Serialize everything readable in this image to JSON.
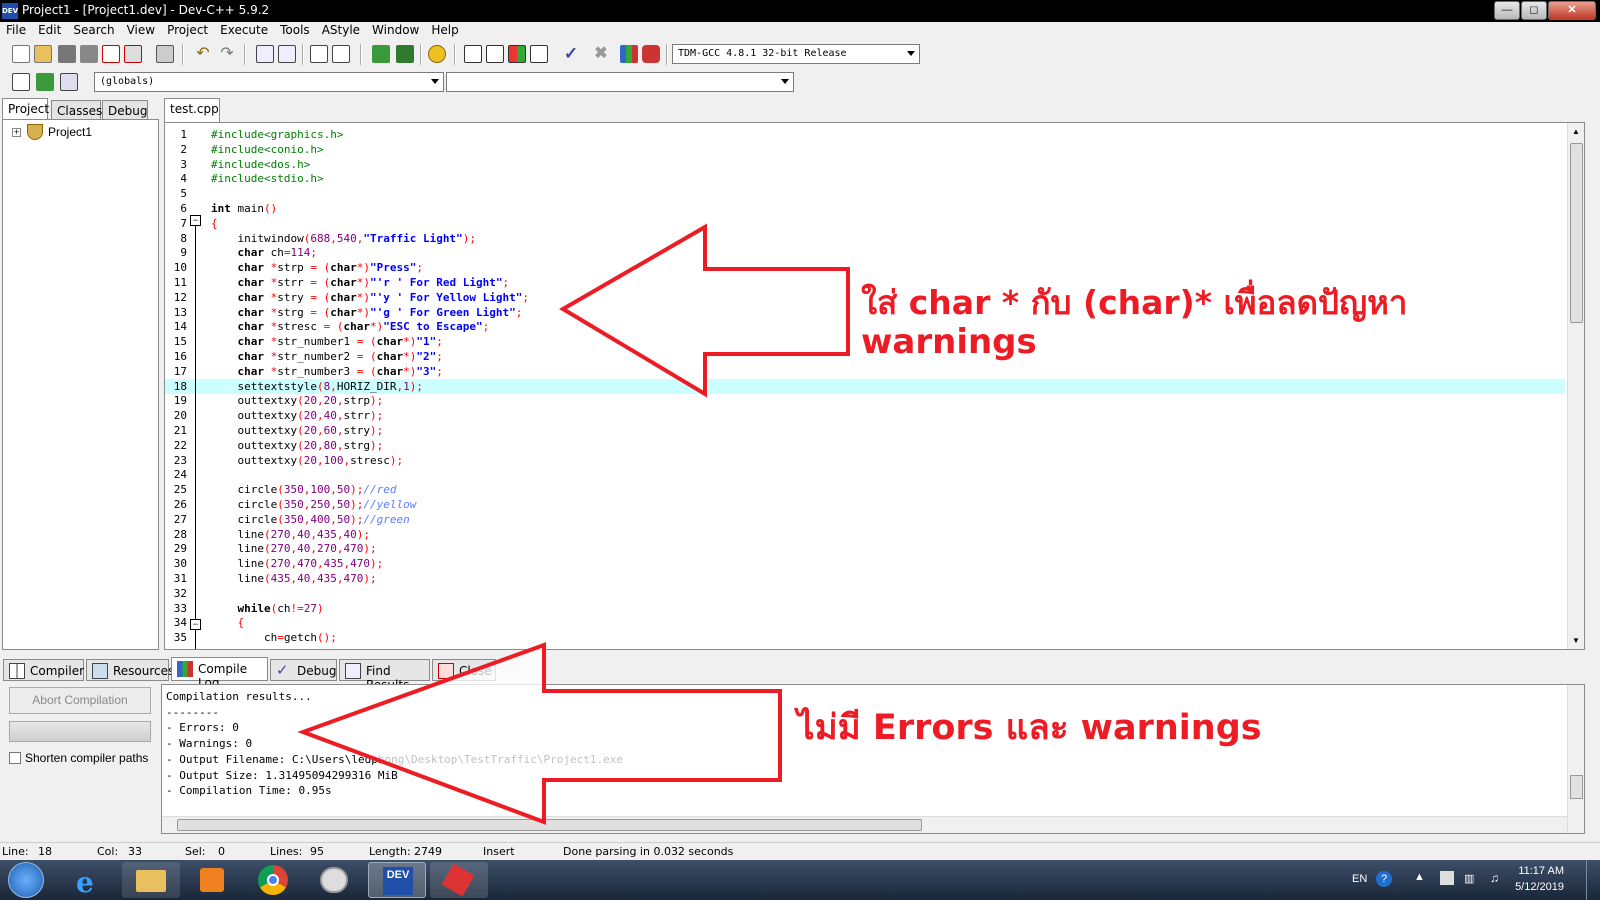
{
  "window": {
    "title": "Project1 - [Project1.dev] - Dev-C++ 5.9.2",
    "app_icon": "DEV"
  },
  "menu": [
    "File",
    "Edit",
    "Search",
    "View",
    "Project",
    "Execute",
    "Tools",
    "AStyle",
    "Window",
    "Help"
  ],
  "toolbar": {
    "compiler": "TDM-GCC 4.8.1 32-bit Release",
    "scope": "(globals)",
    "member": ""
  },
  "left_tabs": [
    "Project",
    "Classes",
    "Debug"
  ],
  "project_tree": {
    "root": "Project1"
  },
  "editor": {
    "tab": "test.cpp",
    "highlighted_line": 18
  },
  "code_lines": [
    "#include<graphics.h>",
    "#include<conio.h>",
    "#include<dos.h>",
    "#include<stdio.h>",
    "",
    "int main()",
    "{",
    "    initwindow(688,540,\"Traffic Light\");",
    "    char ch=114;",
    "    char *strp = (char*)\"Press\";",
    "    char *strr = (char*)\"'r ' For Red Light\";",
    "    char *stry = (char*)\"'y ' For Yellow Light\";",
    "    char *strg = (char*)\"'g ' For Green Light\";",
    "    char *stresc = (char*)\"ESC to Escape\";",
    "    char *str_number1 = (char*)\"1\";",
    "    char *str_number2 = (char*)\"2\";",
    "    char *str_number3 = (char*)\"3\";",
    "    settextstyle(8,HORIZ_DIR,1);",
    "    outtextxy(20,20,strp);",
    "    outtextxy(20,40,strr);",
    "    outtextxy(20,60,stry);",
    "    outtextxy(20,80,strg);",
    "    outtextxy(20,100,stresc);",
    "",
    "    circle(350,100,50);//red",
    "    circle(350,250,50);//yellow",
    "    circle(350,400,50);//green",
    "    line(270,40,435,40);",
    "    line(270,40,270,470);",
    "    line(270,470,435,470);",
    "    line(435,40,435,470);",
    "",
    "    while(ch!=27)",
    "    {",
    "        ch=getch();"
  ],
  "bottom_tabs": [
    "Compiler",
    "Resources",
    "Compile Log",
    "Debug",
    "Find Results",
    "Close"
  ],
  "compile_panel": {
    "abort_label": "Abort Compilation",
    "shorten_label": "Shorten compiler paths"
  },
  "log_lines": [
    "Compilation results...",
    "--------",
    "- Errors: 0",
    "- Warnings: 0",
    "- Output Filename: C:\\Users\\ledphong\\Desktop\\TestTraffic\\Project1.exe",
    "- Output Size: 1.31495094299316 MiB",
    "- Compilation Time: 0.95s"
  ],
  "status": {
    "line_label": "Line:",
    "line": "18",
    "col_label": "Col:",
    "col": "33",
    "sel_label": "Sel:",
    "sel": "0",
    "lines_label": "Lines:",
    "lines": "95",
    "length_label": "Length:",
    "length": "2749",
    "mode": "Insert",
    "message": "Done parsing in 0.032 seconds"
  },
  "annotations": {
    "top_line1": "ใส่ char * กับ (char)* เพื่อลดปัญหา",
    "top_line2": "warnings",
    "bottom": "ไม่มี Errors และ warnings",
    "color": "#ed1c24"
  },
  "taskbar": {
    "lang": "EN",
    "time": "11:17 AM",
    "date": "5/12/2019"
  }
}
